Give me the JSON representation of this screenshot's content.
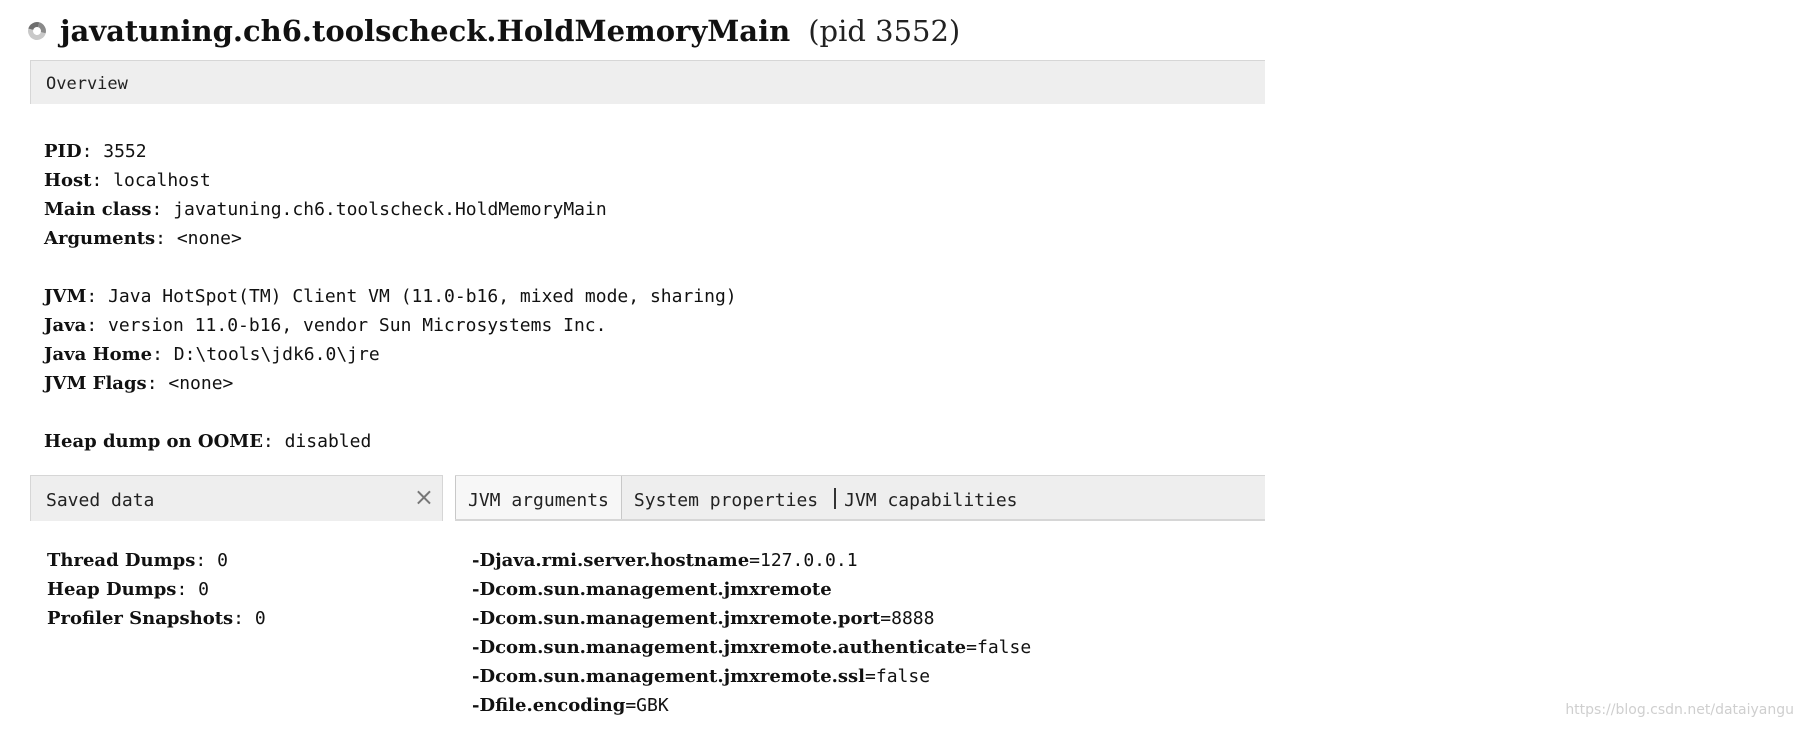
{
  "title": {
    "class_name": "javatuning.ch6.toolscheck.HoldMemoryMain",
    "pid_text": "(pid 3552)",
    "icon": "spinner-icon"
  },
  "overview": {
    "header": "Overview"
  },
  "info": {
    "pid": {
      "label": "PID",
      "value": ": 3552"
    },
    "host": {
      "label": "Host",
      "value": ": localhost"
    },
    "main_class": {
      "label": "Main class",
      "value": ": javatuning.ch6.toolscheck.HoldMemoryMain"
    },
    "arguments": {
      "label": "Arguments",
      "value": ": <none>"
    },
    "jvm": {
      "label": "JVM",
      "value": ": Java HotSpot(TM) Client VM (11.0-b16, mixed mode, sharing)"
    },
    "java": {
      "label": "Java",
      "value": ": version 11.0-b16, vendor Sun Microsystems Inc."
    },
    "java_home": {
      "label": "Java Home",
      "value": ": D:\\tools\\jdk6.0\\jre"
    },
    "jvm_flags": {
      "label": "JVM Flags",
      "value": ": <none>"
    },
    "heap_dump": {
      "label": "Heap dump on OOME",
      "value": ": disabled"
    }
  },
  "saved_data": {
    "header": "Saved data",
    "close_icon": "×",
    "items": [
      {
        "label": "Thread Dumps",
        "value": ": 0"
      },
      {
        "label": "Heap Dumps",
        "value": ": 0"
      },
      {
        "label": "Profiler Snapshots",
        "value": ": 0"
      }
    ]
  },
  "tabs": {
    "jvm_arguments": "JVM arguments",
    "system_properties": "System properties",
    "jvm_capabilities": "JVM capabilities",
    "active": "jvm_arguments"
  },
  "jvm_arguments": [
    {
      "key": "-Djava.rmi.server.hostname",
      "value": "=127.0.0.1"
    },
    {
      "key": "-Dcom.sun.management.jmxremote",
      "value": ""
    },
    {
      "key": "-Dcom.sun.management.jmxremote.port",
      "value": "=8888"
    },
    {
      "key": "-Dcom.sun.management.jmxremote.authenticate",
      "value": "=false"
    },
    {
      "key": "-Dcom.sun.management.jmxremote.ssl",
      "value": "=false"
    },
    {
      "key": "-Dfile.encoding",
      "value": "=GBK"
    }
  ],
  "watermark": "https://blog.csdn.net/dataiyangu"
}
